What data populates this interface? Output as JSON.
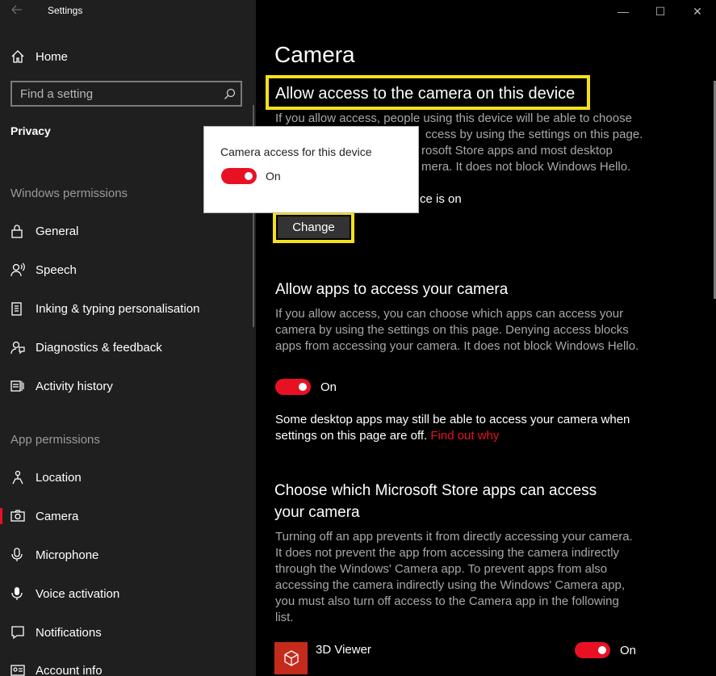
{
  "window": {
    "title": "Settings",
    "controls": {
      "minimize": "—",
      "maximize": "☐",
      "close": "✕"
    }
  },
  "sidebar": {
    "home_label": "Home",
    "search_placeholder": "Find a setting",
    "section_title": "Privacy",
    "windows_permissions_header": "Windows permissions",
    "windows_permissions": [
      {
        "label": "General",
        "icon": "lock-icon"
      },
      {
        "label": "Speech",
        "icon": "speech-icon"
      },
      {
        "label": "Inking & typing personalisation",
        "icon": "inking-icon"
      },
      {
        "label": "Diagnostics & feedback",
        "icon": "diagnostics-icon"
      },
      {
        "label": "Activity history",
        "icon": "activity-history-icon"
      }
    ],
    "app_permissions_header": "App permissions",
    "app_permissions": [
      {
        "label": "Location",
        "icon": "location-icon"
      },
      {
        "label": "Camera",
        "icon": "camera-icon",
        "selected": true
      },
      {
        "label": "Microphone",
        "icon": "microphone-icon"
      },
      {
        "label": "Voice activation",
        "icon": "voice-activation-icon"
      },
      {
        "label": "Notifications",
        "icon": "notifications-icon"
      },
      {
        "label": "Account info",
        "icon": "account-info-icon"
      }
    ]
  },
  "main": {
    "page_title": "Camera",
    "section1": {
      "heading": "Allow access to the camera on this device",
      "desc_lines": [
        "If you allow access, people using this device will be able to choose",
        "ccess by using the settings on this page.",
        "rosoft Store apps and most desktop",
        "mera. It does not block Windows Hello."
      ],
      "status_partial": "ce is on",
      "change_button": "Change"
    },
    "section2": {
      "heading": "Allow apps to access your camera",
      "desc_lines": [
        "If you allow access, you can choose which apps can access your",
        "camera by using the settings on this page. Denying access blocks",
        "apps from accessing your camera. It does not block Windows Hello."
      ],
      "toggle_label": "On",
      "note_line1": "Some desktop apps may still be able to access your camera when",
      "note_line2": "settings on this page are off.",
      "link": "Find out why"
    },
    "section3": {
      "heading_line1": "Choose which Microsoft Store apps can access",
      "heading_line2": "your camera",
      "desc_lines": [
        "Turning off an app prevents it from directly accessing your camera.",
        "It does not prevent the app from accessing the camera indirectly",
        "through the Windows' Camera app. To prevent apps from also",
        "accessing the camera indirectly using the Windows' Camera app,",
        "you must also turn off access to the Camera app in the following",
        "list."
      ],
      "apps": [
        {
          "name": "3D Viewer",
          "toggle_label": "On",
          "icon": "cube-icon"
        }
      ]
    }
  },
  "popup": {
    "title": "Camera access for this device",
    "toggle_label": "On"
  },
  "colors": {
    "accent": "#e81123",
    "highlight": "#f5e11b",
    "sidebar_bg": "#1f1f1f",
    "main_bg": "#000000"
  }
}
